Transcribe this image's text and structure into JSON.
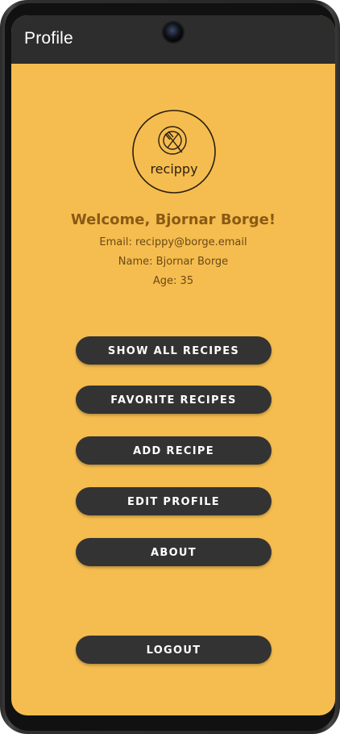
{
  "appbar": {
    "title": "Profile"
  },
  "logo": {
    "text": "recippy",
    "icon": "plate-fork-icon"
  },
  "profile": {
    "welcome": "Welcome, Bjornar Borge!",
    "email": "Email: recippy@borge.email",
    "name": "Name: Bjornar Borge",
    "age": "Age: 35"
  },
  "buttons": {
    "show_all_recipes": "SHOW ALL RECIPES",
    "favorite_recipes": "FAVORITE RECIPES",
    "add_recipe": "ADD RECIPE",
    "edit_profile": "EDIT PROFILE",
    "about": "ABOUT",
    "logout": "LOGOUT"
  },
  "colors": {
    "background": "#f5bd4f",
    "appbar": "#2d2d2d",
    "button": "#333333",
    "button_text": "#ffffff",
    "welcome_text": "#8a5a14"
  }
}
